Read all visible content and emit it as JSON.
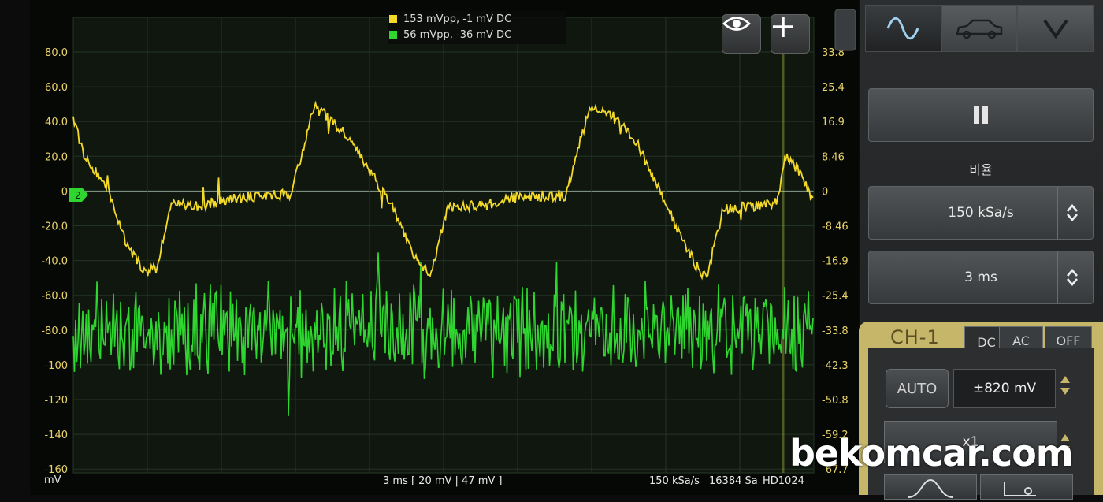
{
  "scope": {
    "left_axis_ticks": [
      "80.0",
      "60.0",
      "40.0",
      "20.0",
      "0",
      "-20.0",
      "-40.0",
      "-60.0",
      "-80.0",
      "-100",
      "-120",
      "-140",
      "-160"
    ],
    "left_unit": "mV",
    "right_axis_ticks": [
      "33.8",
      "25.4",
      "16.9",
      "8.46",
      "0",
      "-8.46",
      "-16.9",
      "-25.4",
      "-33.8",
      "-42.3",
      "-50.8",
      "-59.2",
      "-67.7"
    ],
    "legend": [
      {
        "text": "153 mVpp, -1 mV DC",
        "color": "#f3da2a"
      },
      {
        "text": "56 mVpp, -36 mV DC",
        "color": "#2fd62f"
      }
    ],
    "channel_marker": "2",
    "footer_center": "3 ms  [ 20 mV | 47 mV ]",
    "footer_rate": "150 kSa/s",
    "footer_samples": "16384 Sa",
    "footer_mode": "HD1024",
    "trace_colors": {
      "ch1": "#f3da2a",
      "ch2": "#2fd62f"
    }
  },
  "panel": {
    "modes": [
      {
        "icon": "sine-wave-icon"
      },
      {
        "icon": "car-icon"
      },
      {
        "icon": "chevron-down-icon"
      }
    ],
    "pause_icon": "pause-icon",
    "ratio_label": "비율",
    "sample_rate": "150 kSa/s",
    "timebase": "3 ms",
    "channel": {
      "label": "CH-1",
      "coupling_tabs": [
        "DC",
        "AC",
        "OFF"
      ],
      "auto_label": "AUTO",
      "range": "±820 mV",
      "probe": "x1"
    }
  },
  "watermark": "bekomcar.com"
}
